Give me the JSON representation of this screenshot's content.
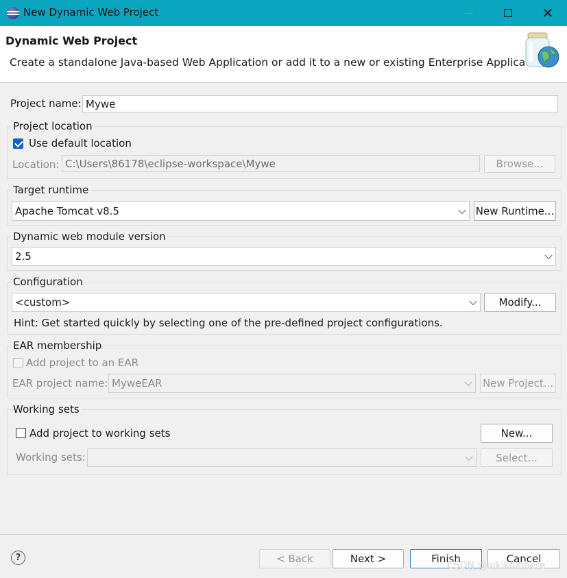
{
  "window": {
    "title": "New Dynamic Web Project"
  },
  "header": {
    "title": "Dynamic Web Project",
    "description": "Create a standalone Java-based Web Application or add it to a new or existing Enterprise Application."
  },
  "project_name": {
    "label": "Project name:",
    "value": "Mywe"
  },
  "project_location": {
    "group_title": "Project location",
    "use_default_label": "Use default location",
    "use_default_checked": true,
    "location_label": "Location:",
    "location_value": "C:\\Users\\86178\\eclipse-workspace\\Mywe",
    "browse_label": "Browse..."
  },
  "target_runtime": {
    "group_title": "Target runtime",
    "selected": "Apache Tomcat v8.5",
    "new_runtime_label": "New Runtime..."
  },
  "module_version": {
    "group_title": "Dynamic web module version",
    "selected": "2.5"
  },
  "configuration": {
    "group_title": "Configuration",
    "selected": "<custom>",
    "modify_label": "Modify...",
    "hint": "Hint: Get started quickly by selecting one of the pre-defined project configurations."
  },
  "ear": {
    "group_title": "EAR membership",
    "add_label": "Add project to an EAR",
    "add_checked": false,
    "project_name_label": "EAR project name:",
    "project_name_value": "MyweEAR",
    "new_project_label": "New Project..."
  },
  "working_sets": {
    "group_title": "Working sets",
    "add_label": "Add project to working sets",
    "add_checked": false,
    "new_label": "New...",
    "sets_label": "Working sets:",
    "sets_value": "",
    "select_label": "Select..."
  },
  "footer": {
    "back_label": "< Back",
    "next_label": "Next >",
    "finish_label": "Finish",
    "cancel_label": "Cancel"
  },
  "watermark": "CSDN @aikikoinhere",
  "colors": {
    "titlebar": "#0aa6bf",
    "accent": "#0b66c2",
    "default_button_border": "#2f7fc8"
  }
}
